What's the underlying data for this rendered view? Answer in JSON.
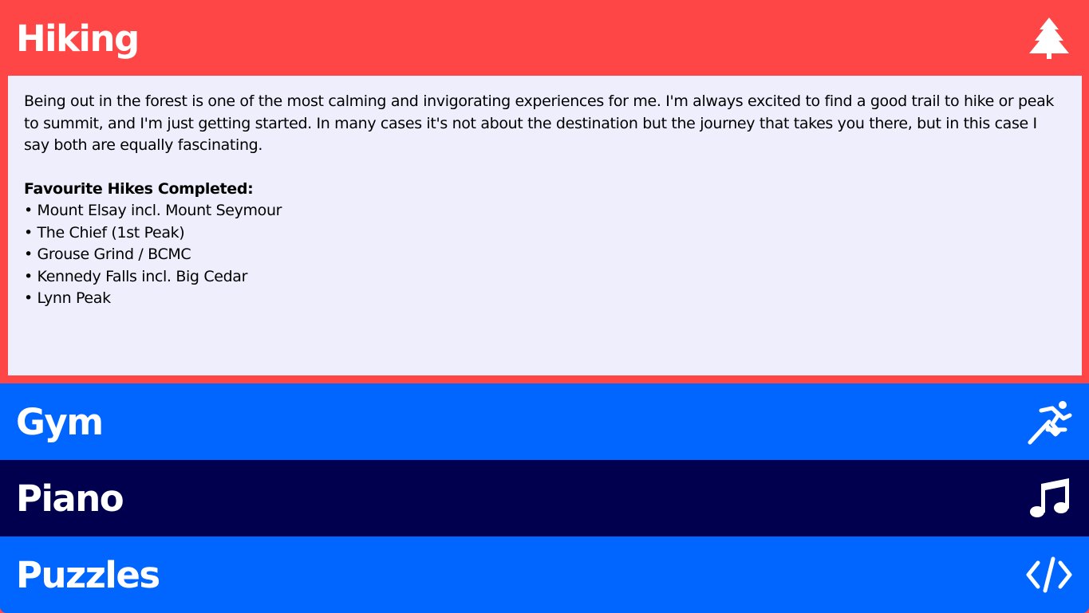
{
  "sections": [
    {
      "title": "Hiking",
      "icon": "tree-icon",
      "expanded": true,
      "color": "#ff4646",
      "body": {
        "paragraph": "Being out in the forest is one of the most calming and invigorating experiences for me. I'm always excited to find a good trail to hike or peak to summit, and I'm just getting started. In many cases it's not about the destination but the journey that takes you there, but in this case I say both are equally fascinating.",
        "list_heading": "Favourite Hikes Completed:",
        "list_items": [
          "• Mount Elsay incl. Mount Seymour",
          "• The Chief (1st Peak)",
          "• Grouse Grind / BCMC",
          "• Kennedy Falls incl. Big Cedar",
          "• Lynn Peak"
        ]
      }
    },
    {
      "title": "Gym",
      "icon": "running-icon",
      "expanded": false,
      "color": "#0066ff"
    },
    {
      "title": "Piano",
      "icon": "music-note-icon",
      "expanded": false,
      "color": "#00004f"
    },
    {
      "title": "Puzzles",
      "icon": "code-icon",
      "expanded": false,
      "color": "#0066ff"
    }
  ],
  "panel_background": "#efeefc"
}
